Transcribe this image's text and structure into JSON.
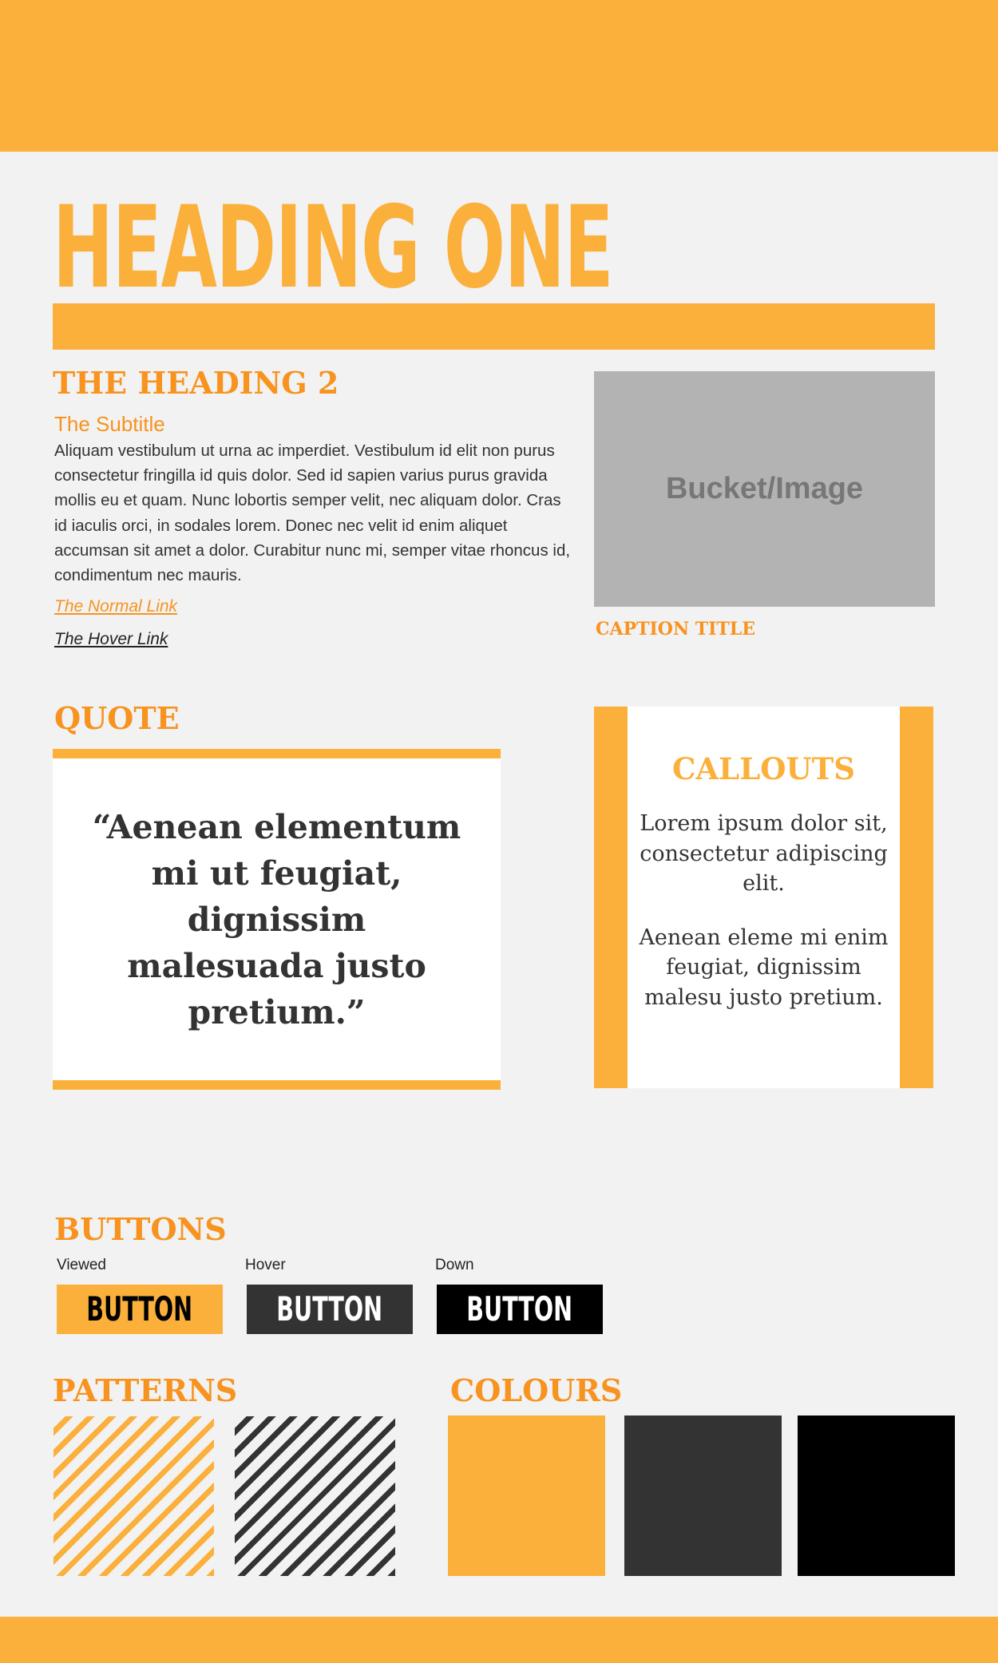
{
  "colors": {
    "orange": "#fbb03b",
    "orange_text": "#f7931e",
    "dark": "#333333",
    "black": "#000000",
    "white": "#ffffff",
    "background": "#f2f2f2",
    "image_placeholder": "#b3b3b3"
  },
  "heading_one": "HEADING ONE",
  "content": {
    "heading_two": "THE HEADING 2",
    "subtitle": "The Subtitle",
    "body": "Aliquam vestibulum ut urna ac imperdiet. Vestibulum id elit non purus consectetur fringilla id quis dolor. Sed id sapien varius purus gravida mollis eu et quam. Nunc lobortis semper velit, nec aliquam dolor. Cras id iaculis orci, in sodales lorem. Donec nec velit id enim aliquet accumsan sit amet a dolor. Curabitur nunc mi, semper vitae rhoncus id, condimentum nec mauris.",
    "normal_link": "The Normal Link",
    "hover_link": "The Hover Link"
  },
  "image": {
    "label": "Bucket/Image",
    "caption": "CAPTION TITLE"
  },
  "quote": {
    "heading": "QUOTE",
    "text": "“Aenean elementum mi ut feugiat, dignissim malesuada justo pretium.”"
  },
  "callouts": {
    "heading": "CALLOUTS",
    "paragraph_1": "Lorem ipsum dolor sit, consectetur adipiscing elit.",
    "paragraph_2": "Aenean eleme mi enim feugiat, dignissim malesu justo pretium."
  },
  "buttons": {
    "heading": "BUTTONS",
    "states": [
      {
        "caption": "Viewed",
        "label": "BUTTON",
        "background": "#fbb03b",
        "text_color": "#000000"
      },
      {
        "caption": "Hover",
        "label": "BUTTON",
        "background": "#333333",
        "text_color": "#ffffff"
      },
      {
        "caption": "Down",
        "label": "BUTTON",
        "background": "#000000",
        "text_color": "#ffffff"
      }
    ]
  },
  "patterns": {
    "heading": "PATTERNS",
    "items": [
      {
        "name": "orange-diagonal-stripes",
        "color": "#fbb03b"
      },
      {
        "name": "dark-diagonal-stripes",
        "color": "#333333"
      }
    ]
  },
  "colours": {
    "heading": "COLOURS",
    "swatches": [
      "#fbb03b",
      "#333333",
      "#000000"
    ]
  }
}
